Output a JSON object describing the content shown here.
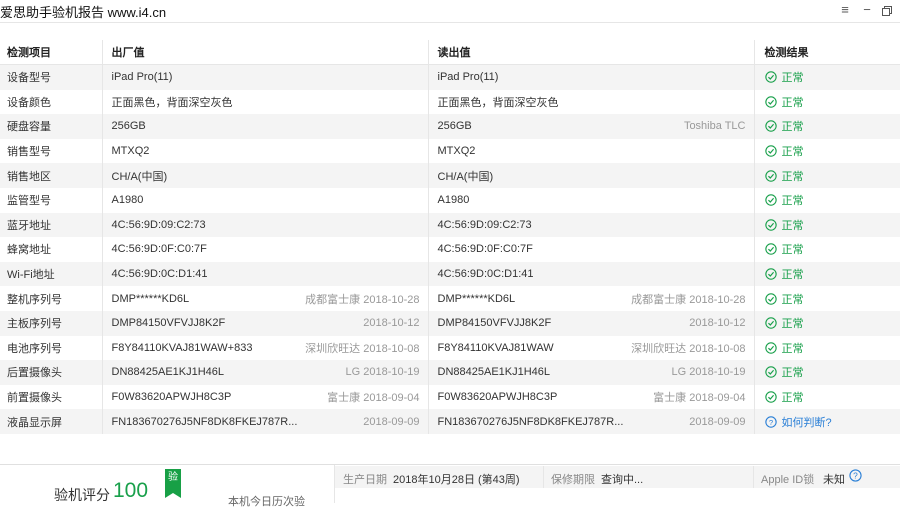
{
  "window": {
    "title": "爱思助手验机报告 www.i4.cn",
    "controls": {
      "menu": "≡",
      "minimize": "−"
    }
  },
  "table": {
    "headers": {
      "item": "检测项目",
      "factory": "出厂值",
      "read": "读出值",
      "result": "检测结果"
    },
    "rows": [
      {
        "label": "设备型号",
        "factory": "iPad Pro(11)",
        "factory_meta": "",
        "read": "iPad Pro(11)",
        "read_meta": "",
        "result": "正常",
        "status": "ok"
      },
      {
        "label": "设备颜色",
        "factory": "正面黑色，背面深空灰色",
        "factory_meta": "",
        "read": "正面黑色，背面深空灰色",
        "read_meta": "",
        "result": "正常",
        "status": "ok"
      },
      {
        "label": "硬盘容量",
        "factory": "256GB",
        "factory_meta": "",
        "read": "256GB",
        "read_meta": "Toshiba TLC",
        "result": "正常",
        "status": "ok"
      },
      {
        "label": "销售型号",
        "factory": "MTXQ2",
        "factory_meta": "",
        "read": "MTXQ2",
        "read_meta": "",
        "result": "正常",
        "status": "ok"
      },
      {
        "label": "销售地区",
        "factory": "CH/A(中国)",
        "factory_meta": "",
        "read": "CH/A(中国)",
        "read_meta": "",
        "result": "正常",
        "status": "ok"
      },
      {
        "label": "监管型号",
        "factory": "A1980",
        "factory_meta": "",
        "read": "A1980",
        "read_meta": "",
        "result": "正常",
        "status": "ok"
      },
      {
        "label": "蓝牙地址",
        "factory": "4C:56:9D:09:C2:73",
        "factory_meta": "",
        "read": "4C:56:9D:09:C2:73",
        "read_meta": "",
        "result": "正常",
        "status": "ok"
      },
      {
        "label": "蜂窝地址",
        "factory": "4C:56:9D:0F:C0:7F",
        "factory_meta": "",
        "read": "4C:56:9D:0F:C0:7F",
        "read_meta": "",
        "result": "正常",
        "status": "ok"
      },
      {
        "label": "Wi-Fi地址",
        "factory": "4C:56:9D:0C:D1:41",
        "factory_meta": "",
        "read": "4C:56:9D:0C:D1:41",
        "read_meta": "",
        "result": "正常",
        "status": "ok"
      },
      {
        "label": "整机序列号",
        "factory": "DMP******KD6L",
        "factory_meta": "成都富士康 2018-10-28",
        "read": "DMP******KD6L",
        "read_meta": "成都富士康 2018-10-28",
        "result": "正常",
        "status": "ok"
      },
      {
        "label": "主板序列号",
        "factory": "DMP84150VFVJJ8K2F",
        "factory_meta": "2018-10-12",
        "read": "DMP84150VFVJJ8K2F",
        "read_meta": "2018-10-12",
        "result": "正常",
        "status": "ok"
      },
      {
        "label": "电池序列号",
        "factory": "F8Y84110KVAJ81WAW+833",
        "factory_meta": "深圳欣旺达 2018-10-08",
        "read": "F8Y84110KVAJ81WAW",
        "read_meta": "深圳欣旺达 2018-10-08",
        "result": "正常",
        "status": "ok"
      },
      {
        "label": "后置摄像头",
        "factory": "DN88425AE1KJ1H46L",
        "factory_meta": "LG 2018-10-19",
        "read": "DN88425AE1KJ1H46L",
        "read_meta": "LG 2018-10-19",
        "result": "正常",
        "status": "ok"
      },
      {
        "label": "前置摄像头",
        "factory": "F0W83620APWJH8C3P",
        "factory_meta": "富士康 2018-09-04",
        "read": "F0W83620APWJH8C3P",
        "read_meta": "富士康 2018-09-04",
        "result": "正常",
        "status": "ok"
      },
      {
        "label": "液晶显示屏",
        "factory": "FN183670276J5NF8DK8FKEJ787R...",
        "factory_meta": "2018-09-09",
        "read": "FN183670276J5NF8DK8FKEJ787R...",
        "read_meta": "2018-09-09",
        "result": "如何判断?",
        "status": "help"
      }
    ]
  },
  "summary": {
    "score_label": "验机评分",
    "score_value": "100",
    "badge_text": "验",
    "sub_note": "本机今日历次验",
    "production_date_label": "生产日期",
    "production_date_value": "2018年10月28日 (第43周)",
    "warranty_label": "保修期限",
    "warranty_value": "查询中...",
    "apple_id_label": "Apple ID锁",
    "apple_id_value": "未知"
  },
  "colors": {
    "ok": "#19a04b",
    "help": "#2a7fd6",
    "zebra": "#f4f4f4"
  }
}
